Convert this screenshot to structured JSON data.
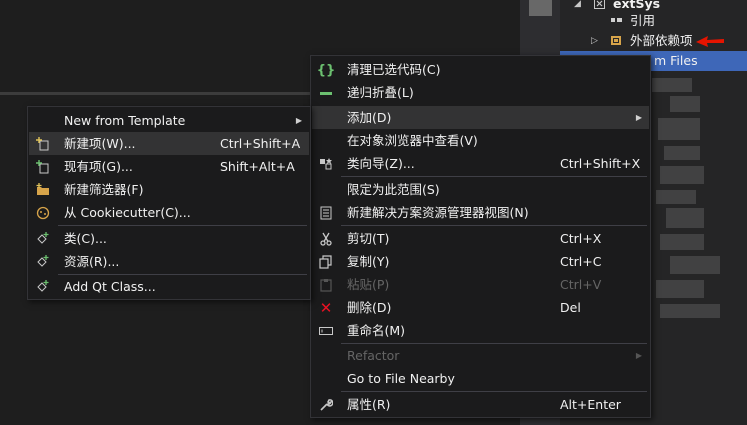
{
  "solution_explorer": {
    "project_name": "extSys",
    "references_label": "引用",
    "external_deps_label": "外部依赖项",
    "selected_item_label": "m Files"
  },
  "left_menu": {
    "items": [
      {
        "label": "New from Template",
        "shortcut": "",
        "icon": "none",
        "has_submenu": true
      },
      {
        "label": "新建项(W)...",
        "shortcut": "Ctrl+Shift+A",
        "icon": "new-item-icon"
      },
      {
        "label": "现有项(G)...",
        "shortcut": "Shift+Alt+A",
        "icon": "existing-item-icon"
      },
      {
        "label": "新建筛选器(F)",
        "shortcut": "",
        "icon": "new-filter-icon"
      },
      {
        "label": "从 Cookiecutter(C)...",
        "shortcut": "",
        "icon": "cookiecutter-icon"
      },
      {
        "label": "类(C)...",
        "shortcut": "",
        "icon": "class-icon"
      },
      {
        "label": "资源(R)...",
        "shortcut": "",
        "icon": "resource-icon"
      },
      {
        "label": "Add Qt Class...",
        "shortcut": "",
        "icon": "qt-class-icon"
      }
    ]
  },
  "right_menu": {
    "items": [
      {
        "label": "清理已选代码(C)",
        "shortcut": "",
        "icon": "braces-icon"
      },
      {
        "label": "递归折叠(L)",
        "shortcut": "",
        "icon": "collapse-icon"
      },
      {
        "label": "添加(D)",
        "shortcut": "",
        "icon": "none",
        "has_submenu": true
      },
      {
        "label": "在对象浏览器中查看(V)",
        "shortcut": "",
        "icon": "none"
      },
      {
        "label": "类向导(Z)...",
        "shortcut": "Ctrl+Shift+X",
        "icon": "class-wizard-icon"
      },
      {
        "label": "限定为此范围(S)",
        "shortcut": "",
        "icon": "none"
      },
      {
        "label": "新建解决方案资源管理器视图(N)",
        "shortcut": "",
        "icon": "new-view-icon"
      },
      {
        "label": "剪切(T)",
        "shortcut": "Ctrl+X",
        "icon": "scissors-icon"
      },
      {
        "label": "复制(Y)",
        "shortcut": "Ctrl+C",
        "icon": "copy-icon"
      },
      {
        "label": "粘贴(P)",
        "shortcut": "Ctrl+V",
        "icon": "paste-icon",
        "disabled": true
      },
      {
        "label": "删除(D)",
        "shortcut": "Del",
        "icon": "delete-icon"
      },
      {
        "label": "重命名(M)",
        "shortcut": "",
        "icon": "rename-icon"
      },
      {
        "label": "Refactor",
        "shortcut": "",
        "icon": "none",
        "has_submenu": true,
        "disabled": true
      },
      {
        "label": "Go to File Nearby",
        "shortcut": "",
        "icon": "none"
      },
      {
        "label": "属性(R)",
        "shortcut": "Alt+Enter",
        "icon": "wrench-icon"
      }
    ]
  },
  "colors": {
    "menu_bg": "#1b1b1c",
    "hover_bg": "#333334",
    "selection_blue": "#3e67b8",
    "accent_red": "#e51400",
    "braces_green": "#6cc070",
    "delete_red": "#e81123"
  }
}
